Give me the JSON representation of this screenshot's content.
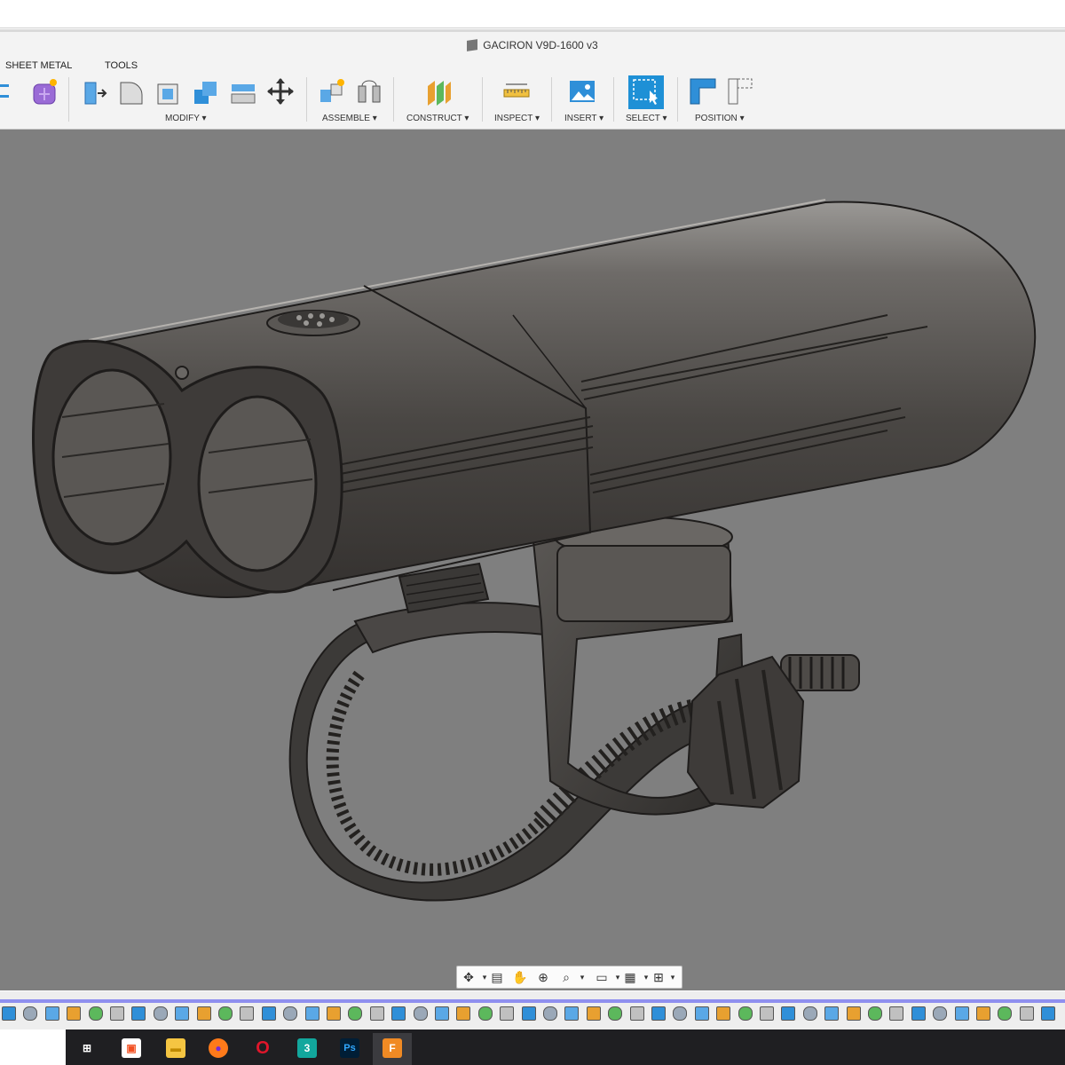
{
  "window": {
    "title": "GACIRON V9D-1600 v3"
  },
  "tabs": [
    "SHEET METAL",
    "TOOLS"
  ],
  "toolbar_groups": [
    {
      "label": "MODIFY",
      "arrow": "▾"
    },
    {
      "label": "ASSEMBLE",
      "arrow": "▾"
    },
    {
      "label": "CONSTRUCT",
      "arrow": "▾"
    },
    {
      "label": "INSPECT",
      "arrow": "▾"
    },
    {
      "label": "INSERT",
      "arrow": "▾"
    },
    {
      "label": "SELECT",
      "arrow": "▾"
    },
    {
      "label": "POSITION",
      "arrow": "▾"
    }
  ],
  "navbar": {
    "items": [
      "orbit-icon",
      "look-at-icon",
      "pan-icon",
      "zoom-window-icon",
      "zoom-icon",
      "display-settings-icon",
      "grid-icon",
      "viewports-icon"
    ]
  },
  "taskbar": {
    "apps": [
      {
        "name": "task-view",
        "glyph": "⊞"
      },
      {
        "name": "microsoft-store",
        "glyph": "▣"
      },
      {
        "name": "file-explorer",
        "glyph": "▬"
      },
      {
        "name": "firefox",
        "glyph": "●"
      },
      {
        "name": "opera",
        "glyph": "O"
      },
      {
        "name": "3ds-max",
        "glyph": "3"
      },
      {
        "name": "photoshop",
        "glyph": "Ps"
      },
      {
        "name": "fusion-360",
        "glyph": "F"
      }
    ]
  },
  "colors": {
    "viewport": "#7f7f7f",
    "accent_blue": "#1e90d6",
    "timeline_bar": "#8f8fef"
  }
}
